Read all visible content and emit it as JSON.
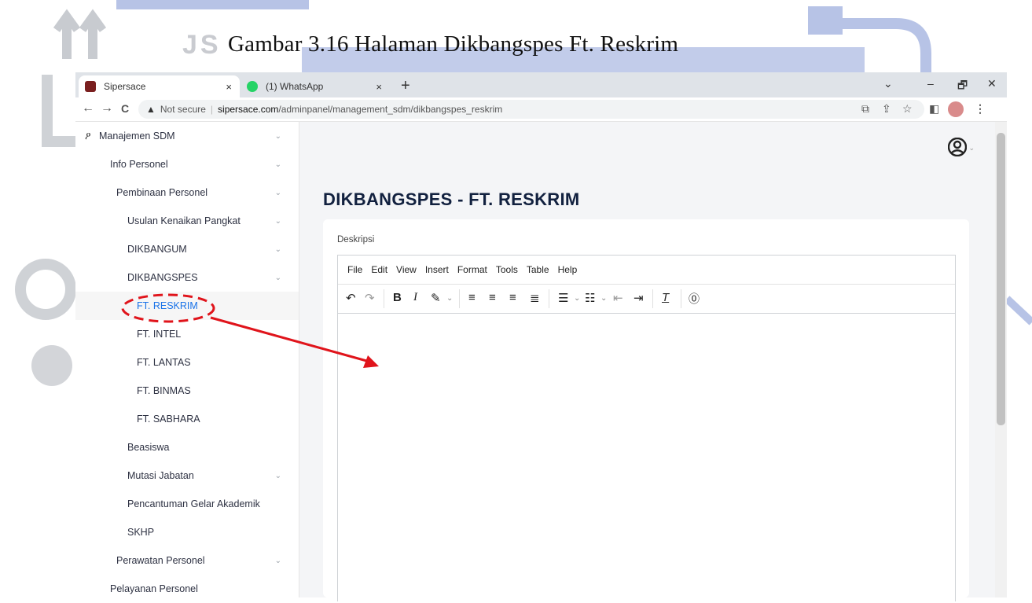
{
  "caption": "Gambar 3.16 Halaman Dikbangspes Ft. Reskrim",
  "watermark_text": "JS",
  "browser": {
    "tabs": [
      {
        "label": "Sipersace",
        "close": "×"
      },
      {
        "label": "(1) WhatsApp",
        "close": "×"
      }
    ],
    "new_tab": "+",
    "window_controls": {
      "dropdown": "⌄",
      "minimize": "–",
      "restore": "🗗",
      "close": "✕"
    },
    "nav": {
      "back": "←",
      "forward": "→",
      "reload": "C"
    },
    "security_label": "Not secure",
    "url_host": "sipersace.com",
    "url_path": "/adminpanel/management_sdm/dikbangspes_reskrim"
  },
  "sidebar": {
    "items": [
      {
        "label": "Manajemen SDM",
        "level": 0,
        "has_chevron": true
      },
      {
        "label": "Info Personel",
        "level": 1,
        "has_chevron": true
      },
      {
        "label": "Pembinaan Personel",
        "level": 2,
        "has_chevron": true
      },
      {
        "label": "Usulan Kenaikan Pangkat",
        "level": 3,
        "has_chevron": true
      },
      {
        "label": "DIKBANGUM",
        "level": 3,
        "has_chevron": true
      },
      {
        "label": "DIKBANGSPES",
        "level": 3,
        "has_chevron": true
      },
      {
        "label": "FT. RESKRIM",
        "level": 4,
        "has_chevron": false,
        "active": true
      },
      {
        "label": "FT. INTEL",
        "level": 4,
        "has_chevron": false
      },
      {
        "label": "FT. LANTAS",
        "level": 4,
        "has_chevron": false
      },
      {
        "label": "FT. BINMAS",
        "level": 4,
        "has_chevron": false
      },
      {
        "label": "FT. SABHARA",
        "level": 4,
        "has_chevron": false
      },
      {
        "label": "Beasiswa",
        "level": 3,
        "has_chevron": false
      },
      {
        "label": "Mutasi Jabatan",
        "level": 3,
        "has_chevron": true
      },
      {
        "label": "Pencantuman Gelar Akademik",
        "level": 3,
        "has_chevron": false
      },
      {
        "label": "SKHP",
        "level": 3,
        "has_chevron": false
      },
      {
        "label": "Perawatan Personel",
        "level": 2,
        "has_chevron": true
      },
      {
        "label": "Pelayanan Personel",
        "level": 1,
        "has_chevron": false
      }
    ]
  },
  "main": {
    "title": "DIKBANGSPES - FT. RESKRIM",
    "field_label": "Deskripsi",
    "editor_menu": [
      "File",
      "Edit",
      "View",
      "Insert",
      "Format",
      "Tools",
      "Table",
      "Help"
    ]
  },
  "colors": {
    "active_link": "#1a73e8",
    "annotation": "#e0141b",
    "watermark_blue": "#b7c3e6"
  }
}
